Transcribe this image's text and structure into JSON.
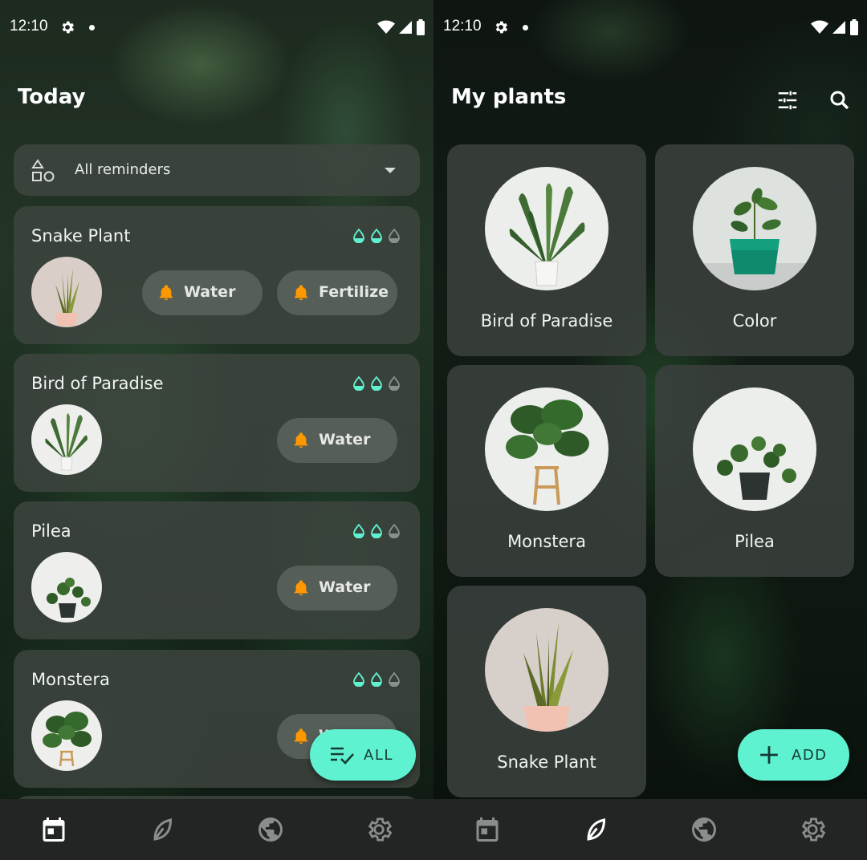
{
  "status_bar": {
    "time": "12:10"
  },
  "today_screen": {
    "title": "Today",
    "filter": {
      "label": "All reminders"
    },
    "reminders": [
      {
        "name": "Snake Plant",
        "actions": [
          "Water",
          "Fertilize"
        ]
      },
      {
        "name": "Bird of Paradise",
        "actions": [
          "Water"
        ]
      },
      {
        "name": "Pilea",
        "actions": [
          "Water"
        ]
      },
      {
        "name": "Monstera",
        "actions": [
          "Water"
        ]
      }
    ],
    "fab_label": "ALL"
  },
  "plants_screen": {
    "title": "My plants",
    "plants": [
      {
        "name": "Bird of Paradise"
      },
      {
        "name": "Color"
      },
      {
        "name": "Monstera"
      },
      {
        "name": "Pilea"
      },
      {
        "name": "Snake Plant"
      }
    ],
    "fab_label": "ADD"
  },
  "navigation": {
    "items": [
      "calendar-icon",
      "leaf-icon",
      "globe-icon",
      "settings-icon"
    ]
  },
  "colors": {
    "accent": "#5ff2d1",
    "bell": "#ff9800",
    "drop_filled": "#5ff2d1",
    "drop_empty": "#8a908b"
  }
}
